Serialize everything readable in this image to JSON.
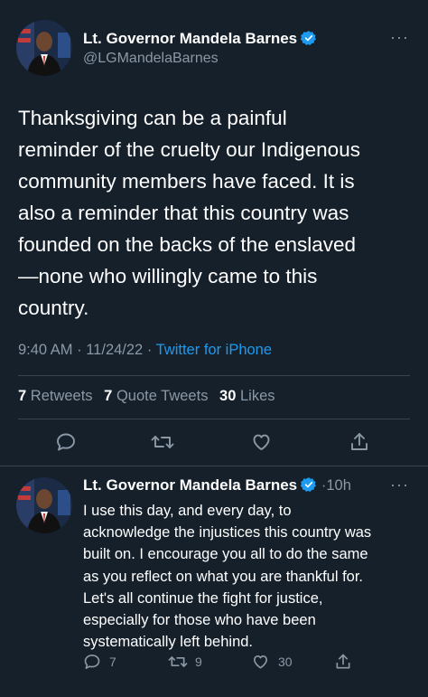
{
  "tweet": {
    "display_name": "Lt. Governor Mandela Barnes",
    "handle": "@LGMandelaBarnes",
    "text": "Thanksgiving can be a painful\nreminder of the cruelty our Indigenous\ncommunity members have faced. It is\nalso a reminder that this country was\nfounded on the backs of the enslaved\n—none who willingly came to this\ncountry.",
    "time": "9:40 AM",
    "date": "11/24/22",
    "source": "Twitter for iPhone",
    "separator": "·",
    "stats": {
      "retweets_count": "7",
      "retweets_label": "Retweets",
      "quotes_count": "7",
      "quotes_label": "Quote Tweets",
      "likes_count": "30",
      "likes_label": "Likes"
    }
  },
  "reply": {
    "display_name": "Lt. Governor Mandela Barnes",
    "time": "10h",
    "separator": "·",
    "text": "I use this day, and every day, to\nacknowledge the injustices this country was\nbuilt on. I encourage you all to do the same\nas you reflect on what you are thankful for.\nLet's all continue the fight for justice,\nespecially for those who have been\nsystematically left behind.",
    "reply_count": "7",
    "retweet_count": "9",
    "like_count": "30"
  },
  "icons": [
    "verified-badge-icon",
    "more-icon",
    "reply-icon",
    "retweet-icon",
    "like-icon",
    "share-icon"
  ],
  "colors": {
    "background": "#15202b",
    "text": "#ffffff",
    "secondary": "#8b98a5",
    "accent": "#1d9bf0",
    "divider": "#38444d"
  },
  "more_label": "···"
}
